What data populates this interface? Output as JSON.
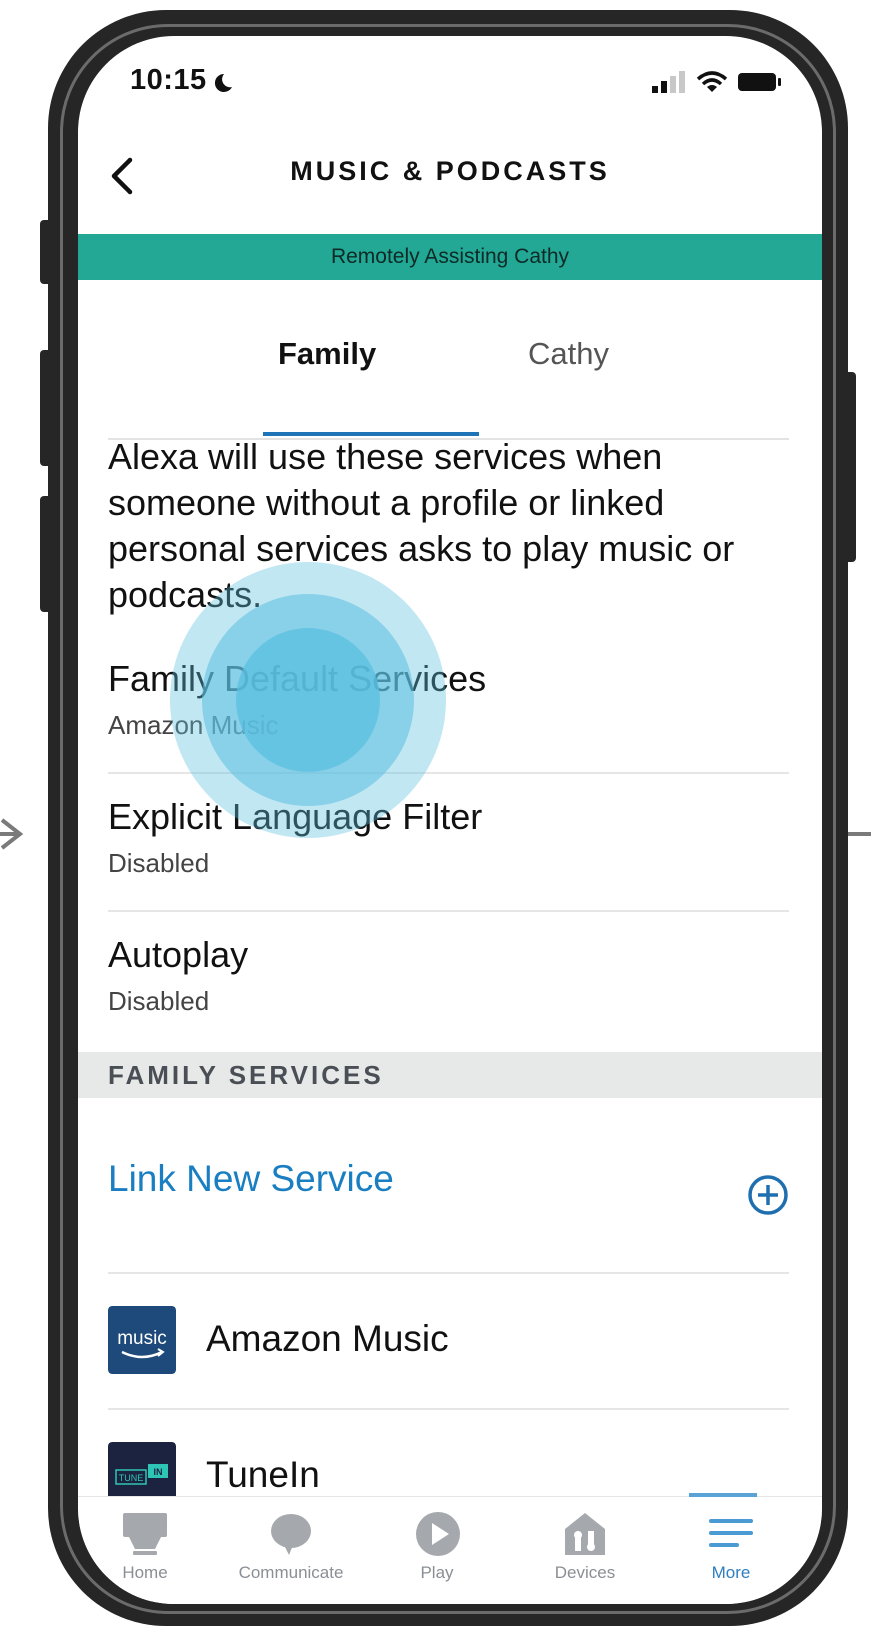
{
  "status_bar": {
    "time": "10:15"
  },
  "header": {
    "title": "MUSIC & PODCASTS"
  },
  "banner": {
    "text": "Remotely Assisting Cathy",
    "color": "#22a894"
  },
  "tabs": [
    {
      "label": "Family",
      "selected": true
    },
    {
      "label": "Cathy",
      "selected": false
    }
  ],
  "description": "Alexa will use these services when someone without a profile or linked personal services asks to play music or podcasts.",
  "settings": [
    {
      "title": "Family Default Services",
      "value": "Amazon Music"
    },
    {
      "title": "Explicit Language Filter",
      "value": "Disabled"
    },
    {
      "title": "Autoplay",
      "value": "Disabled"
    }
  ],
  "family_services": {
    "heading": "FAMILY SERVICES",
    "link_label": "Link New Service",
    "services": [
      {
        "name": "Amazon Music",
        "icon": "amazon-music-logo"
      },
      {
        "name": "TuneIn",
        "icon": "tunein-logo"
      }
    ]
  },
  "bottom_nav": [
    {
      "label": "Home",
      "icon": "home-icon",
      "active": false
    },
    {
      "label": "Communicate",
      "icon": "speech-bubble-icon",
      "active": false
    },
    {
      "label": "Play",
      "icon": "play-icon",
      "active": false
    },
    {
      "label": "Devices",
      "icon": "devices-icon",
      "active": false
    },
    {
      "label": "More",
      "icon": "menu-icon",
      "active": true
    }
  ],
  "colors": {
    "accent": "#1a7ec2",
    "banner": "#22a894",
    "touch_indicator": "#5bbfe0"
  }
}
